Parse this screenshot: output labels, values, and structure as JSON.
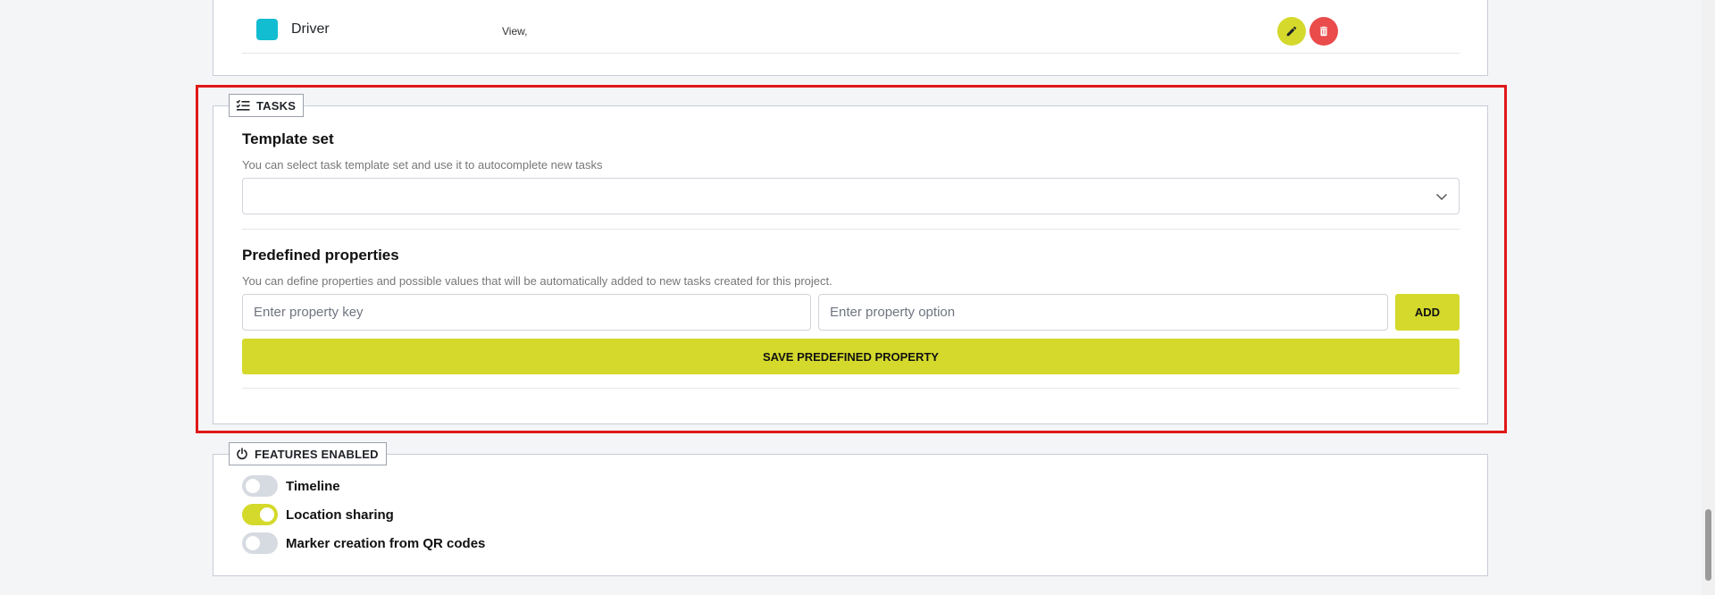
{
  "roles": {
    "rows": [
      {
        "name": "Driver",
        "permissions": "View,",
        "color": "#12bcd1"
      }
    ]
  },
  "tasks": {
    "legend": "TASKS",
    "template_set": {
      "title": "Template set",
      "description": "You can select task template set and use it to autocomplete new tasks",
      "selected": ""
    },
    "predefined": {
      "title": "Predefined properties",
      "description": "You can define properties and possible values that will be automatically added to new tasks created for this project.",
      "key_placeholder": "Enter property key",
      "option_placeholder": "Enter property option",
      "add_label": "ADD",
      "save_label": "SAVE PREDEFINED PROPERTY"
    }
  },
  "features": {
    "legend": "FEATURES ENABLED",
    "items": [
      {
        "label": "Timeline",
        "enabled": false
      },
      {
        "label": "Location sharing",
        "enabled": true
      },
      {
        "label": "Marker creation from QR codes",
        "enabled": false
      }
    ]
  },
  "colors": {
    "accent": "#d4d92c",
    "danger": "#ea4b4b",
    "highlight": "#e01818"
  }
}
